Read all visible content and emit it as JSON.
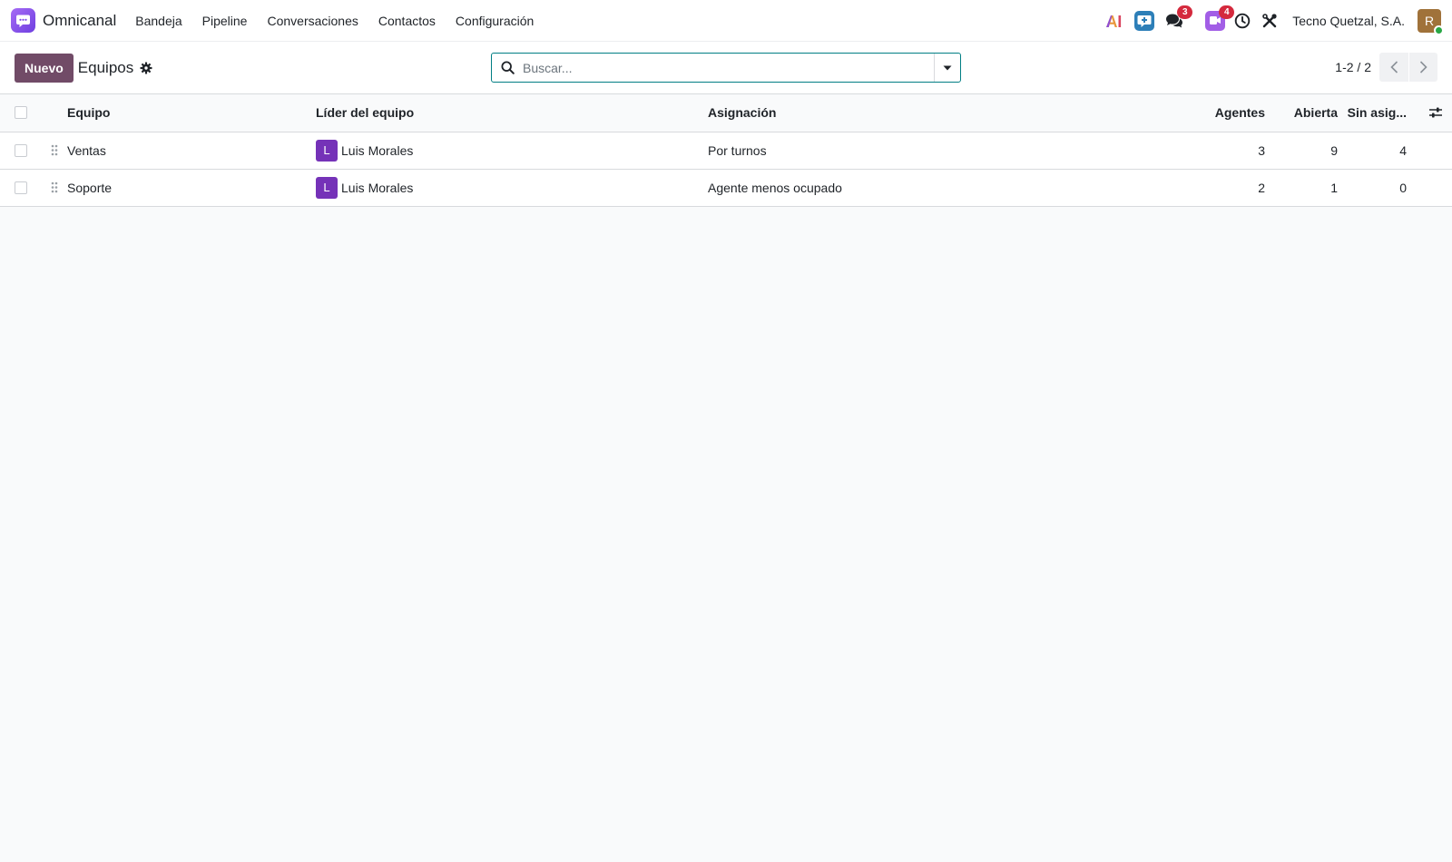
{
  "app": {
    "name": "Omnicanal",
    "menu": [
      "Bandeja",
      "Pipeline",
      "Conversaciones",
      "Contactos",
      "Configuración"
    ]
  },
  "systray": {
    "ai_label": "AI",
    "messages_badge": "3",
    "activities_badge": "4",
    "company": "Tecno Quetzal, S.A.",
    "user_initial": "R"
  },
  "control_panel": {
    "new_label": "Nuevo",
    "title": "Equipos",
    "search_placeholder": "Buscar...",
    "pager_value": "1-2 / 2"
  },
  "table": {
    "headers": {
      "team": "Equipo",
      "leader": "Líder del equipo",
      "assignment": "Asignación",
      "agents": "Agentes",
      "open": "Abierta",
      "unassigned": "Sin asig..."
    },
    "rows": [
      {
        "team": "Ventas",
        "leader_initial": "L",
        "leader": "Luis Morales",
        "assignment": "Por turnos",
        "agents": "3",
        "open": "9",
        "unassigned": "4"
      },
      {
        "team": "Soporte",
        "leader_initial": "L",
        "leader": "Luis Morales",
        "assignment": "Agente menos ocupado",
        "agents": "2",
        "open": "1",
        "unassigned": "0"
      }
    ]
  },
  "colors": {
    "primary": "#714b67",
    "accent": "#017e84",
    "app_logo": "#8b5cf6",
    "leader_avatar": "#7532b8",
    "badge": "#d4293d",
    "user_avatar": "#a0723a"
  }
}
